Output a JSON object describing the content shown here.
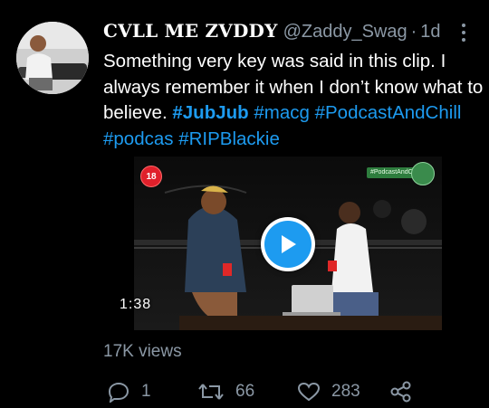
{
  "tweet": {
    "display_name": "CVLL ME ZVDDY",
    "handle": "@Zaddy_Swag",
    "separator": "·",
    "time": "1d",
    "text_plain": "Something very key was said in this clip. I always remember it when I don’t know what to believe.",
    "hashtags": [
      "#JubJub",
      "#macg",
      "#PodcastAndChill",
      "#podcas",
      "#RIPBlackie"
    ],
    "more_icon": "more-vertical-icon",
    "avatar_icon": "user-avatar-photo"
  },
  "media": {
    "badge": "18",
    "show_tag": "#PodcastAndChill",
    "duration": "1:38",
    "play_icon": "play-icon"
  },
  "stats": {
    "views": "17K views",
    "replies": "1",
    "retweets": "66",
    "likes": "283",
    "reply_icon": "comment-icon",
    "retweet_icon": "retweet-icon",
    "like_icon": "heart-icon",
    "share_icon": "share-icon"
  },
  "colors": {
    "background": "#000000",
    "text": "#ffffff",
    "muted": "#8b98a5",
    "link": "#1d9bf0",
    "play": "#1d9bf0"
  }
}
